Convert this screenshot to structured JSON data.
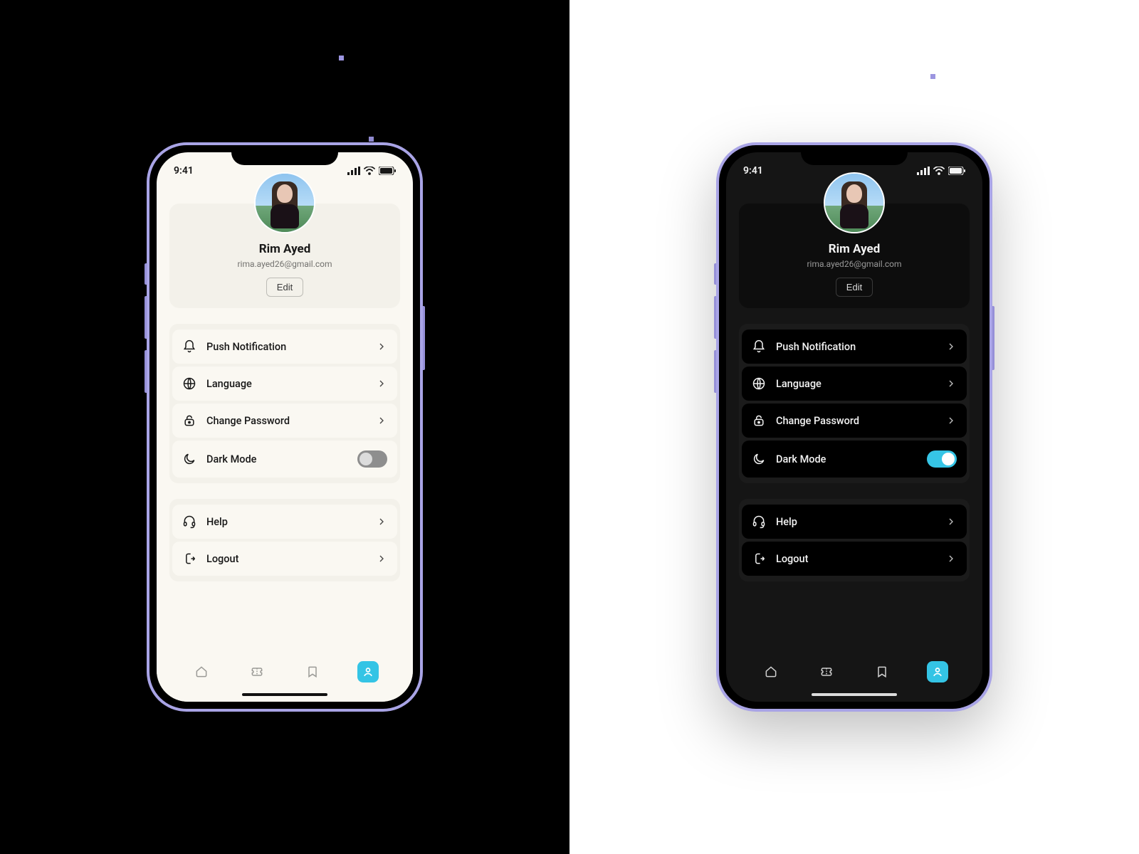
{
  "status": {
    "time": "9:41"
  },
  "profile": {
    "name": "Rim Ayed",
    "email": "rima.ayed26@gmail.com",
    "edit_label": "Edit"
  },
  "settings": {
    "push": {
      "label": "Push Notification"
    },
    "lang": {
      "label": "Language"
    },
    "pass": {
      "label": "Change Password"
    },
    "dark": {
      "label": "Dark Mode"
    }
  },
  "support": {
    "help": {
      "label": "Help"
    },
    "logout": {
      "label": "Logout"
    }
  },
  "nav": {
    "home": "home-icon",
    "tickets": "ticket-icon",
    "saved": "bookmark-icon",
    "profile": "profile-icon"
  },
  "colors": {
    "accent": "#34c4e5",
    "device": "#a9a4e6"
  },
  "left": {
    "theme": "light",
    "dark_mode_on": false
  },
  "right": {
    "theme": "dark",
    "dark_mode_on": true
  }
}
